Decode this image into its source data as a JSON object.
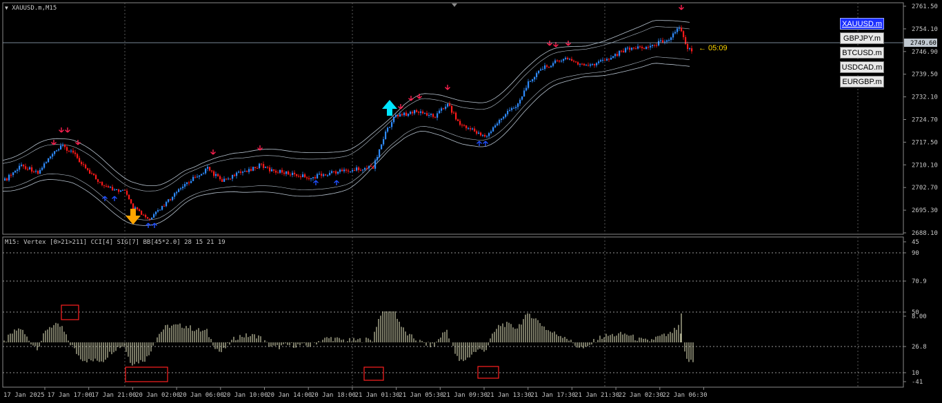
{
  "window": {
    "title": "XAUUSD.m,M15",
    "collapse_icon": "triangle-down-icon",
    "countdown": "← 05:09",
    "indicator_title": "M15: Vertex [0>21>211] CCI[4] SIG[7] BB[45*2.0]  28 15 21 19"
  },
  "symbols": [
    {
      "label": "XAUUSD.m",
      "active": true
    },
    {
      "label": "GBPJPY.m",
      "active": false
    },
    {
      "label": "BTCUSD.m",
      "active": false
    },
    {
      "label": "USDCAD.m",
      "active": false
    },
    {
      "label": "EURGBP.m",
      "active": false
    }
  ],
  "colors": {
    "background": "#000000",
    "bull_candle": "#2f8cff",
    "bear_candle": "#ff1a1a",
    "grid": "#5a5a5a",
    "bands": "#b8c4d0",
    "signal_down": "#ff2050",
    "signal_up": "#2050ff",
    "big_arrow_up": "#00e5ff",
    "big_arrow_down": "#ffa500",
    "histogram": "#f0f0c8",
    "highlight_box": "#ff2020",
    "price_line": "#a0b4c8"
  },
  "price_axis": {
    "labels": [
      "2761.50",
      "2754.10",
      "2746.90",
      "2739.50",
      "2732.10",
      "2724.70",
      "2717.50",
      "2710.10",
      "2702.70",
      "2695.30",
      "2688.10"
    ],
    "current_price": "2749.60"
  },
  "indicator_axis": {
    "labels": [
      "45",
      "90",
      "70.9",
      "50",
      "8.00",
      "26.8",
      "10",
      "-41"
    ]
  },
  "time_axis": {
    "labels": [
      "17 Jan 2025",
      "17 Jan 17:00",
      "17 Jan 21:00",
      "20 Jan 02:00",
      "20 Jan 06:00",
      "20 Jan 10:00",
      "20 Jan 14:00",
      "20 Jan 18:00",
      "21 Jan 01:30",
      "21 Jan 05:30",
      "21 Jan 09:30",
      "21 Jan 13:30",
      "21 Jan 17:30",
      "21 Jan 21:30",
      "22 Jan 02:30",
      "22 Jan 06:30"
    ]
  }
}
